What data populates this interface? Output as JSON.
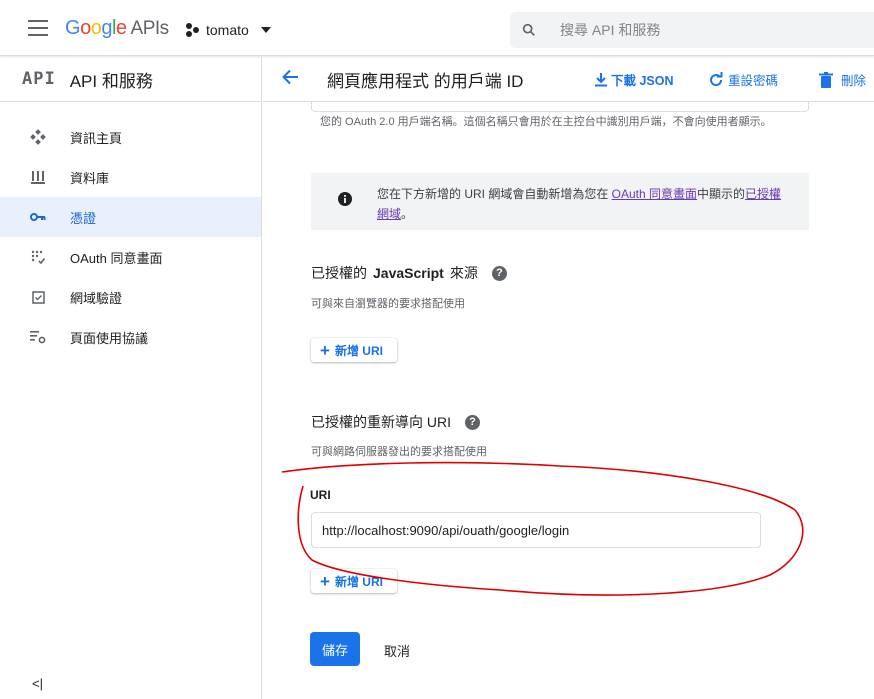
{
  "topbar": {
    "logo_google": "Google",
    "logo_apis": "APIs",
    "project": "tomato",
    "search_placeholder": "搜尋 API 和服務"
  },
  "sidebar": {
    "mark": "API",
    "title": "API 和服務",
    "items": [
      {
        "label": "資訊主頁",
        "icon": "dashboard-icon",
        "active": false
      },
      {
        "label": "資料庫",
        "icon": "library-icon",
        "active": false
      },
      {
        "label": "憑證",
        "icon": "key-icon",
        "active": true
      },
      {
        "label": "OAuth 同意畫面",
        "icon": "consent-icon",
        "active": false
      },
      {
        "label": "網域驗證",
        "icon": "domain-check-icon",
        "active": false
      },
      {
        "label": "頁面使用協議",
        "icon": "settings-list-icon",
        "active": false
      }
    ],
    "collapse_label": "<|"
  },
  "header": {
    "title": "網頁應用程式 的用戶端 ID",
    "download_label": "下載 JSON",
    "reset_label": "重設密碼",
    "delete_label": "刪除"
  },
  "content": {
    "name_help": "您的 OAuth 2.0 用戶端名稱。這個名稱只會用於在主控台中識別用戶端，不會向使用者顯示。",
    "info_prefix": "您在下方新增的 URI 網域會自動新增為您在 ",
    "info_link1": "OAuth 同意畫面",
    "info_middle": "中顯示的",
    "info_link2": "已授權網域",
    "info_suffix": "。",
    "js_origins": {
      "title_prefix": "已授權的 ",
      "title_bold": "JavaScript",
      "title_suffix": " 來源",
      "subtitle": "可與來自瀏覽器的要求搭配使用",
      "add_label": "新增 URI"
    },
    "redirect": {
      "title": "已授權的重新導向 URI",
      "subtitle": "可與網路伺服器發出的要求搭配使用",
      "uri_label": "URI",
      "uri_value": "http://localhost:9090/api/ouath/google/login",
      "add_label": "新增 URI"
    },
    "save_label": "儲存",
    "cancel_label": "取消"
  },
  "colors": {
    "accent": "#1a73e8",
    "active_bg": "#e8f0fe",
    "annotation": "#e00000"
  }
}
